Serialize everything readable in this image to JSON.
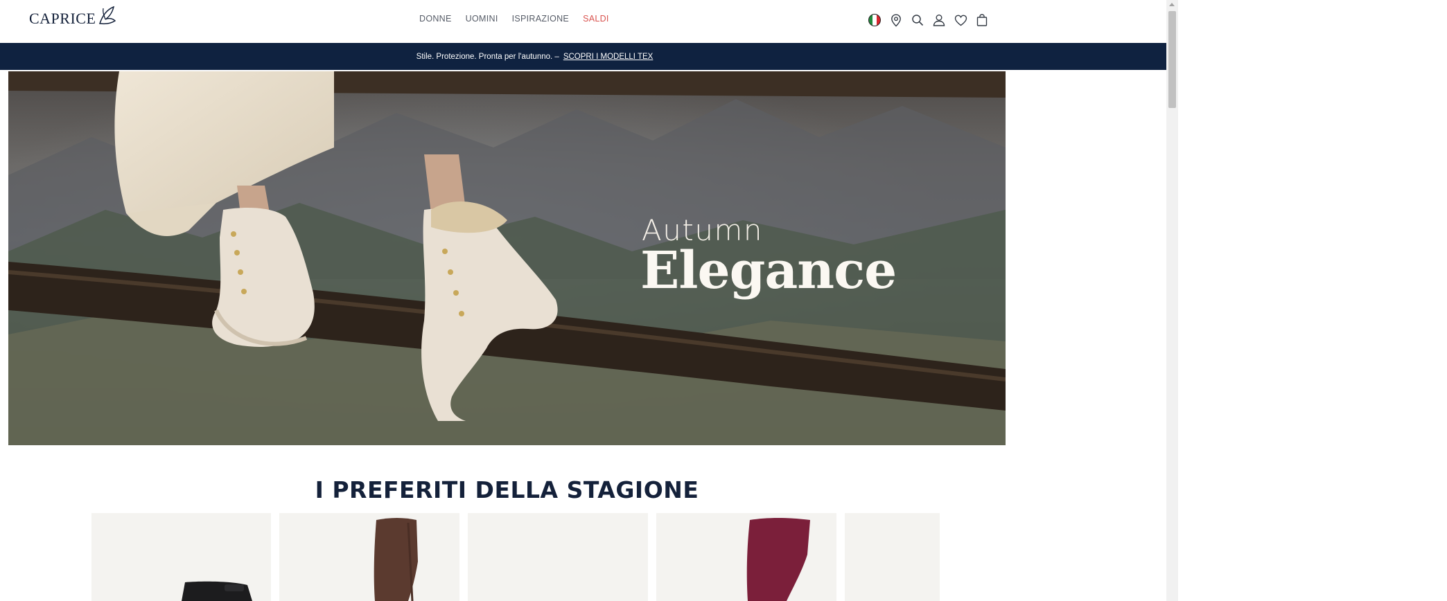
{
  "brand": {
    "name": "CAPRICE"
  },
  "nav": {
    "items": [
      "DONNE",
      "UOMINI",
      "ISPIRAZIONE",
      "SALDI"
    ]
  },
  "header_icons": [
    "italy-flag-icon",
    "location-pin-icon",
    "search-icon",
    "account-icon",
    "wishlist-heart-icon",
    "shopping-bag-icon"
  ],
  "promo": {
    "text": "Stile. Protezione. Pronta per l'autunno. –",
    "link": "SCOPRI I MODELLI TEX"
  },
  "hero": {
    "line1": "Autumn",
    "line2": "Elegance"
  },
  "section": {
    "title": "I PREFERITI DELLA STAGIONE"
  },
  "colors": {
    "navy": "#0f2240",
    "title": "#14213a",
    "sale": "#d9534f",
    "card_bg": "#f4f3f0"
  }
}
